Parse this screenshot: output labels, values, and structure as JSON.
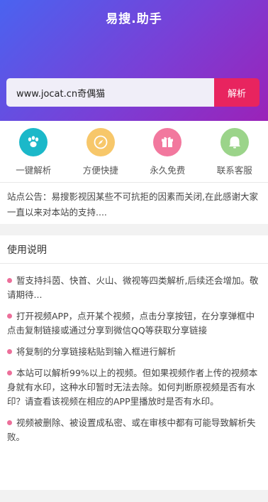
{
  "header": {
    "logo": "易搜.助手"
  },
  "search": {
    "value": "www.jocat.cn奇偶猫",
    "button_label": "解析"
  },
  "features": [
    {
      "label": "一键解析",
      "icon": "paw-icon",
      "color": "#1bb8c9"
    },
    {
      "label": "方便快捷",
      "icon": "compass-icon",
      "color": "#f7c76a"
    },
    {
      "label": "永久免费",
      "icon": "gift-icon",
      "color": "#f2789e"
    },
    {
      "label": "联系客服",
      "icon": "chat-bubble-icon",
      "color": "#9bd48a"
    }
  ],
  "notice": {
    "text": "站点公告：易搜影视因某些不可抗拒的因素而关闭,在此感谢大家一直以来对本站的支持...."
  },
  "usage": {
    "title": "使用说明",
    "items": [
      "暂支持抖茵、快首、火山、微视等四类解析,后续还会增加。敬请期待...",
      "打开视频APP，点开某个视频，点击分享按钮，在分享弹框中点击复制链接或通过分享到微信QQ等获取分享链接",
      "将复制的分享链接粘贴到输入框进行解析",
      "本站可以解析99%以上的视频。但如果视频作者上传的视频本身就有水印，这种水印暂时无法去除。如何判断原视频是否有水印？请查看该视频在相应的APP里播放时是否有水印。",
      "视频被删除、被设置成私密、或在审核中都有可能导致解析失败。"
    ]
  }
}
